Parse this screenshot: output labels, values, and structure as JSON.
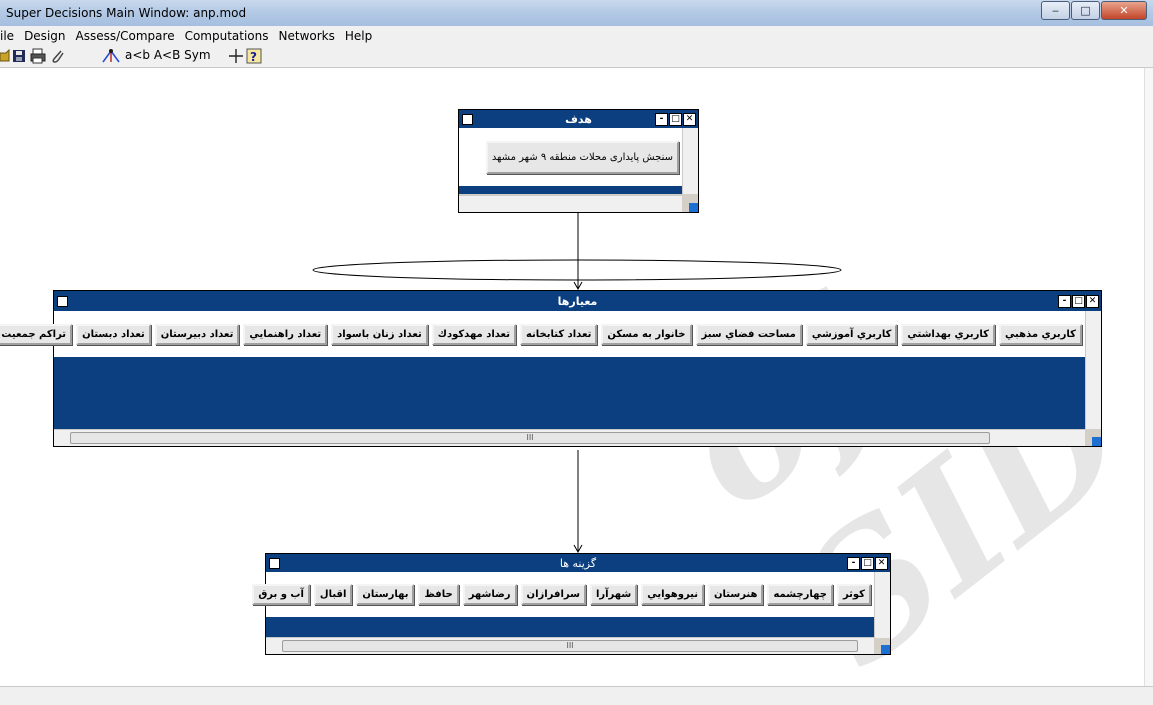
{
  "window": {
    "title": "Super Decisions Main Window: anp.mod",
    "controls": [
      "‒",
      "□",
      "✕"
    ]
  },
  "menu": [
    "ile",
    "Design",
    "Assess/Compare",
    "Computations",
    "Networks",
    "Help"
  ],
  "toolbar": {
    "sym_text": "a<b A<B Sym"
  },
  "watermark": "of SID",
  "goal_cluster": {
    "title": "هدف",
    "nodes": [
      "سنجش پایداری محلات منطقه ۹ شهر مشهد"
    ]
  },
  "criteria_cluster": {
    "title": "معیارها",
    "nodes": [
      "كاربري مذهبي",
      "كاربري بهداشتي",
      "كاربري آموزشي",
      "مساحت فضاي سبز",
      "خانوار به مسكن",
      "تعداد كتابخانه",
      "تعداد مهدكودك",
      "تعداد زنان باسواد",
      "تعداد راهنمايي",
      "تعداد دبيرستان",
      "تعداد دبستان",
      "تراكم جمعيت"
    ]
  },
  "alternatives_cluster": {
    "title": "گزینه ها",
    "nodes": [
      "كوثر",
      "چهارچشمه",
      "هنرستان",
      "نيروهوايي",
      "شهرآرا",
      "سرافرازان",
      "رضاشهر",
      "حافظ",
      "بهارستان",
      "اقبال",
      "آب و برق"
    ]
  },
  "scroll_glyph": "III",
  "colors": {
    "cluster_header": "#0b3f80",
    "titlebar": "#b4cae6",
    "close": "#c2452a"
  }
}
